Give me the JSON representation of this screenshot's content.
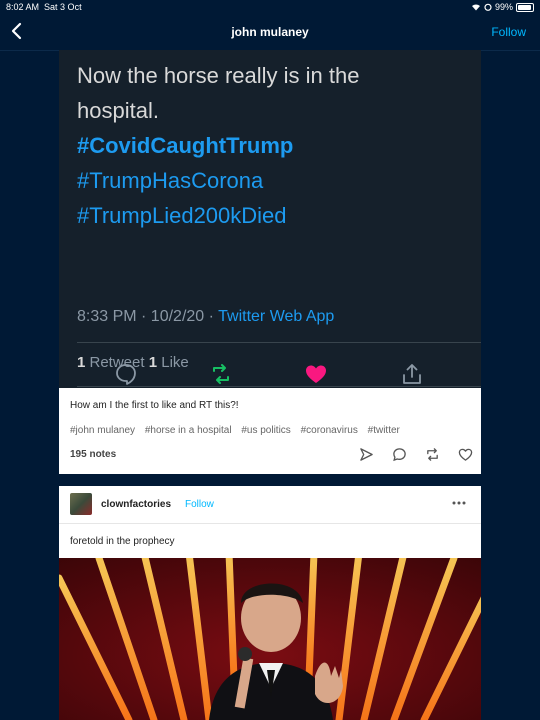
{
  "status_bar": {
    "time": "8:02 AM",
    "date": "Sat 3 Oct",
    "battery": "99%"
  },
  "nav": {
    "title": "john mulaney",
    "follow_label": "Follow"
  },
  "tweet": {
    "lines": [
      "Now the horse really is in the",
      "hospital."
    ],
    "hashtags": [
      "#CovidCaughtTrump",
      "#TrumpHasCorona",
      "#TrumpLied200kDied"
    ],
    "timestamp": "8:33 PM · 10/2/20 · ",
    "source": "Twitter Web App",
    "retweet_count": "1",
    "retweet_label": " Retweet ",
    "like_count": "1",
    "like_label": " Like",
    "colors": {
      "background": "#15202b",
      "link": "#1d9bf0",
      "retweet": "#17bf63",
      "like": "#f91880"
    }
  },
  "post1": {
    "caption": "How am I the first to like and RT this?!",
    "tags": [
      "#john mulaney",
      "#horse in a hospital",
      "#us politics",
      "#coronavirus",
      "#twitter"
    ],
    "notes": "195 notes"
  },
  "post2": {
    "blog": "clownfactories",
    "follow_label": "Follow",
    "caption": "foretold in the prophecy"
  },
  "colors": {
    "app_bg": "#001935",
    "accent": "#00b8ff"
  }
}
